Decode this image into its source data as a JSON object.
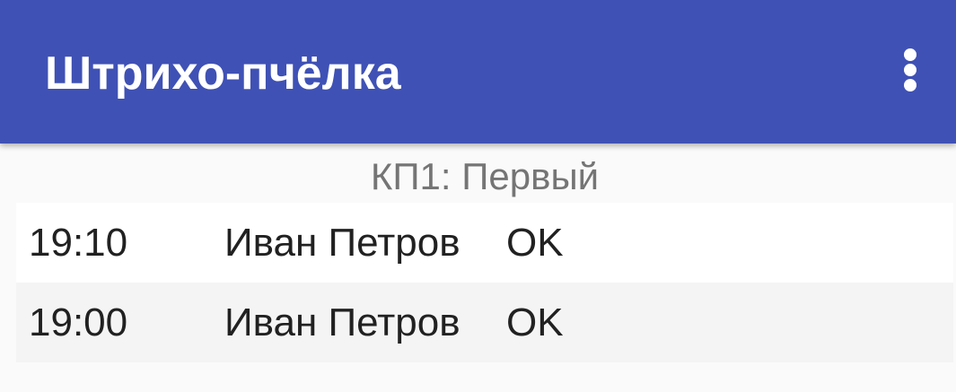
{
  "appbar": {
    "title": "Штрихо-пчёлка",
    "background_color": "#3f51b5",
    "overflow_icon": "more-vert-icon"
  },
  "checkpoint": {
    "title": "КП1: Первый"
  },
  "entries": [
    {
      "time": "19:10",
      "name": "Иван Петров",
      "status": "OK"
    },
    {
      "time": "19:00",
      "name": "Иван Петров",
      "status": "OK"
    }
  ]
}
